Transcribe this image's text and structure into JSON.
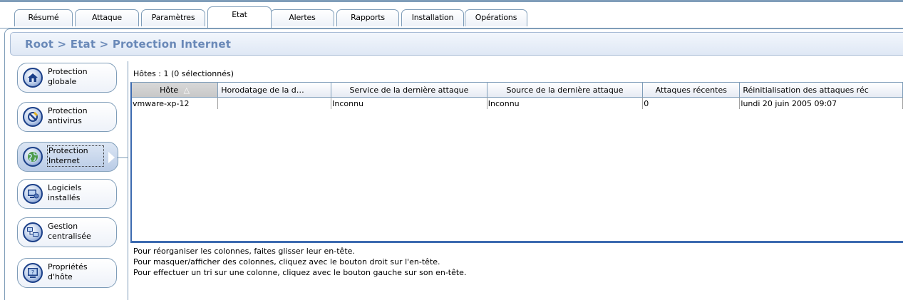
{
  "tabs": [
    {
      "label": "Résumé",
      "active": false
    },
    {
      "label": "Attaque",
      "active": false
    },
    {
      "label": "Paramètres",
      "active": false
    },
    {
      "label": "Etat",
      "active": true
    },
    {
      "label": "Alertes",
      "active": false
    },
    {
      "label": "Rapports",
      "active": false
    },
    {
      "label": "Installation",
      "active": false
    },
    {
      "label": "Opérations",
      "active": false
    }
  ],
  "breadcrumb": "Root > Etat > Protection Internet",
  "nav": [
    {
      "label": "Protection\nglobale",
      "icon": "home-icon",
      "selected": false
    },
    {
      "label": "Protection\nantivirus",
      "icon": "antivirus-icon",
      "selected": false
    },
    {
      "label": "Protection\nInternet",
      "icon": "internet-globe-icon",
      "selected": true
    },
    {
      "label": "Logiciels\ninstallés",
      "icon": "installed-software-icon",
      "selected": false
    },
    {
      "label": "Gestion\ncentralisée",
      "icon": "central-management-icon",
      "selected": false
    },
    {
      "label": "Propriétés\nd'hôte",
      "icon": "host-properties-icon",
      "selected": false
    }
  ],
  "hosts_label": "Hôtes : 1 (0 sélectionnés)",
  "table": {
    "columns": [
      "Hôte",
      "Horodatage de la d…",
      "Service de la dernière attaque",
      "Source de la dernière attaque",
      "Attaques récentes",
      "Réinitialisation des attaques réc"
    ],
    "sort_indicator": "△",
    "rows": [
      [
        "vmware-xp-12",
        "",
        "Inconnu",
        "Inconnu",
        "0",
        "lundi 20 juin 2005 09:07"
      ]
    ]
  },
  "help_lines": [
    "Pour réorganiser les colonnes, faites glisser leur en-tête.",
    "Pour masquer/afficher des colonnes, cliquez avec le bouton droit sur l'en-tête.",
    "Pour effectuer un tri sur une colonne, cliquez avec le bouton gauche sur son en-tête."
  ],
  "colors": {
    "accent": "#3c6ab0",
    "crumb_text": "#6a89b8",
    "border": "#7f9db9"
  }
}
